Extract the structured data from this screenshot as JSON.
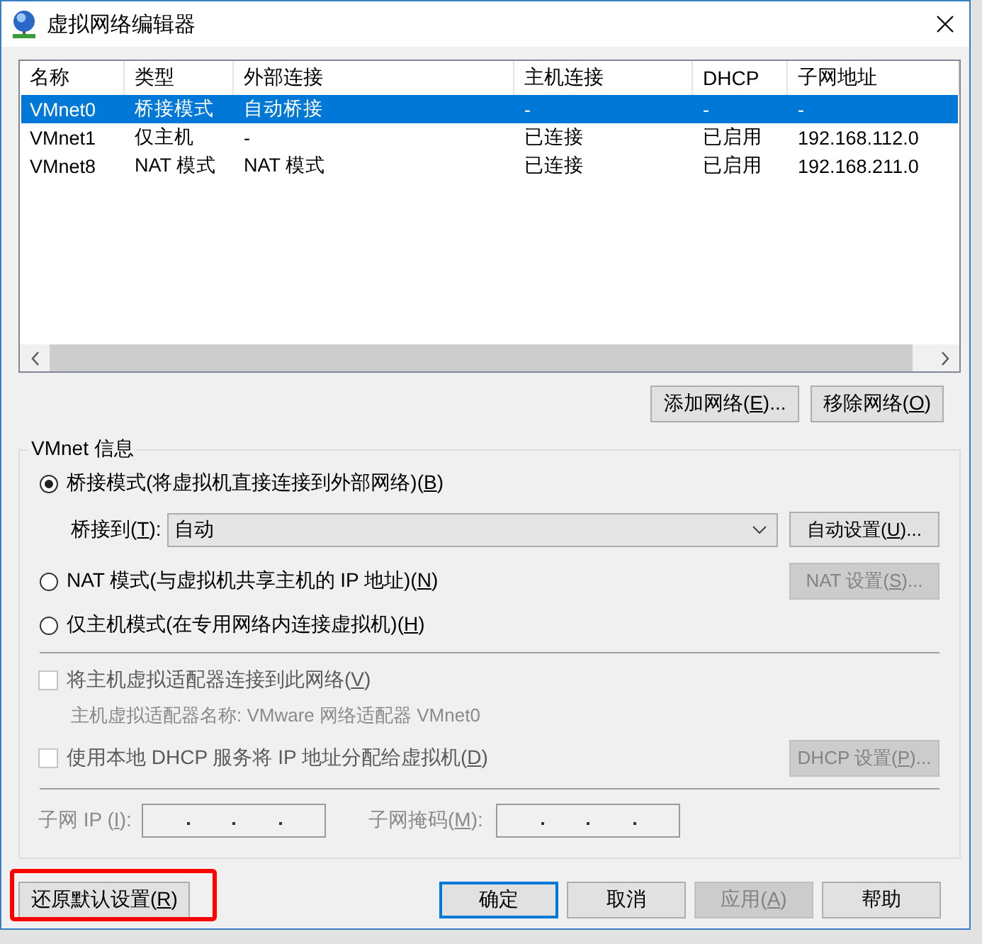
{
  "window": {
    "title": "虚拟网络编辑器"
  },
  "table": {
    "columns": [
      "名称",
      "类型",
      "外部连接",
      "主机连接",
      "DHCP",
      "子网地址"
    ],
    "rows": [
      {
        "cells": [
          "VMnet0",
          "桥接模式",
          "自动桥接",
          "-",
          "-",
          "-"
        ],
        "selected": true
      },
      {
        "cells": [
          "VMnet1",
          "仅主机",
          "-",
          "已连接",
          "已启用",
          "192.168.112.0"
        ],
        "selected": false
      },
      {
        "cells": [
          "VMnet8",
          "NAT 模式",
          "NAT 模式",
          "已连接",
          "已启用",
          "192.168.211.0"
        ],
        "selected": false
      }
    ]
  },
  "table_buttons": [
    {
      "label": {
        "text": "添加网络(",
        "key": "E",
        "end": ")..."
      },
      "disabled": false
    },
    {
      "label": {
        "text": "移除网络(",
        "key": "O",
        "end": ")"
      },
      "disabled": false
    }
  ],
  "vmnet_info": {
    "title": "VMnet 信息",
    "modes": [
      {
        "label": {
          "text": "桥接模式(将虚拟机直接连接到外部网络)(",
          "key": "B",
          "end": ")"
        },
        "selected": true,
        "bridge_to": {
          "label": {
            "text": "桥接到(",
            "key": "T",
            "end": "):"
          },
          "value": "自动",
          "button": {
            "label": {
              "text": "自动设置(",
              "key": "U",
              "end": ")..."
            },
            "disabled": false
          }
        }
      },
      {
        "label": {
          "text": "NAT 模式(与虚拟机共享主机的 IP 地址)(",
          "key": "N",
          "end": ")"
        },
        "selected": false,
        "button": {
          "label": {
            "text": "NAT 设置(",
            "key": "S",
            "end": ")..."
          },
          "disabled": true
        }
      },
      {
        "label": {
          "text": "仅主机模式(在专用网络内连接虚拟机)(",
          "key": "H",
          "end": ")"
        },
        "selected": false
      }
    ],
    "connect_adapter": {
      "label": {
        "text": "将主机虚拟适配器连接到此网络(",
        "key": "V",
        "end": ")"
      },
      "checked": false,
      "disabled": true
    },
    "adapter_name": {
      "text": "主机虚拟适配器名称: VMware 网络适配器 VMnet0",
      "disabled": true
    },
    "dhcp": {
      "label": {
        "text": "使用本地 DHCP 服务将 IP 地址分配给虚拟机(",
        "key": "D",
        "end": ")"
      },
      "checked": false,
      "disabled": true,
      "button": {
        "label": {
          "text": "DHCP 设置(",
          "key": "P",
          "end": ")..."
        },
        "disabled": true
      }
    },
    "subnet_fields": [
      {
        "label": {
          "text": "子网 IP (",
          "key": "I",
          "end": "):"
        },
        "disabled": true
      },
      {
        "label": {
          "text": "子网掩码(",
          "key": "M",
          "end": "):"
        },
        "disabled": true
      }
    ]
  },
  "footer": {
    "reset_button": {
      "label": {
        "text": "还原默认设置(",
        "key": "R",
        "end": ")"
      },
      "disabled": false,
      "highlighted": true
    },
    "buttons": [
      {
        "label": {
          "text": "确定"
        },
        "disabled": false,
        "focused": true
      },
      {
        "label": {
          "text": "取消"
        },
        "disabled": false,
        "focused": false
      },
      {
        "label": {
          "text": "应用(",
          "key": "A",
          "end": ")"
        },
        "disabled": true,
        "focused": false
      },
      {
        "label": {
          "text": "帮助"
        },
        "disabled": false,
        "focused": false
      }
    ]
  }
}
